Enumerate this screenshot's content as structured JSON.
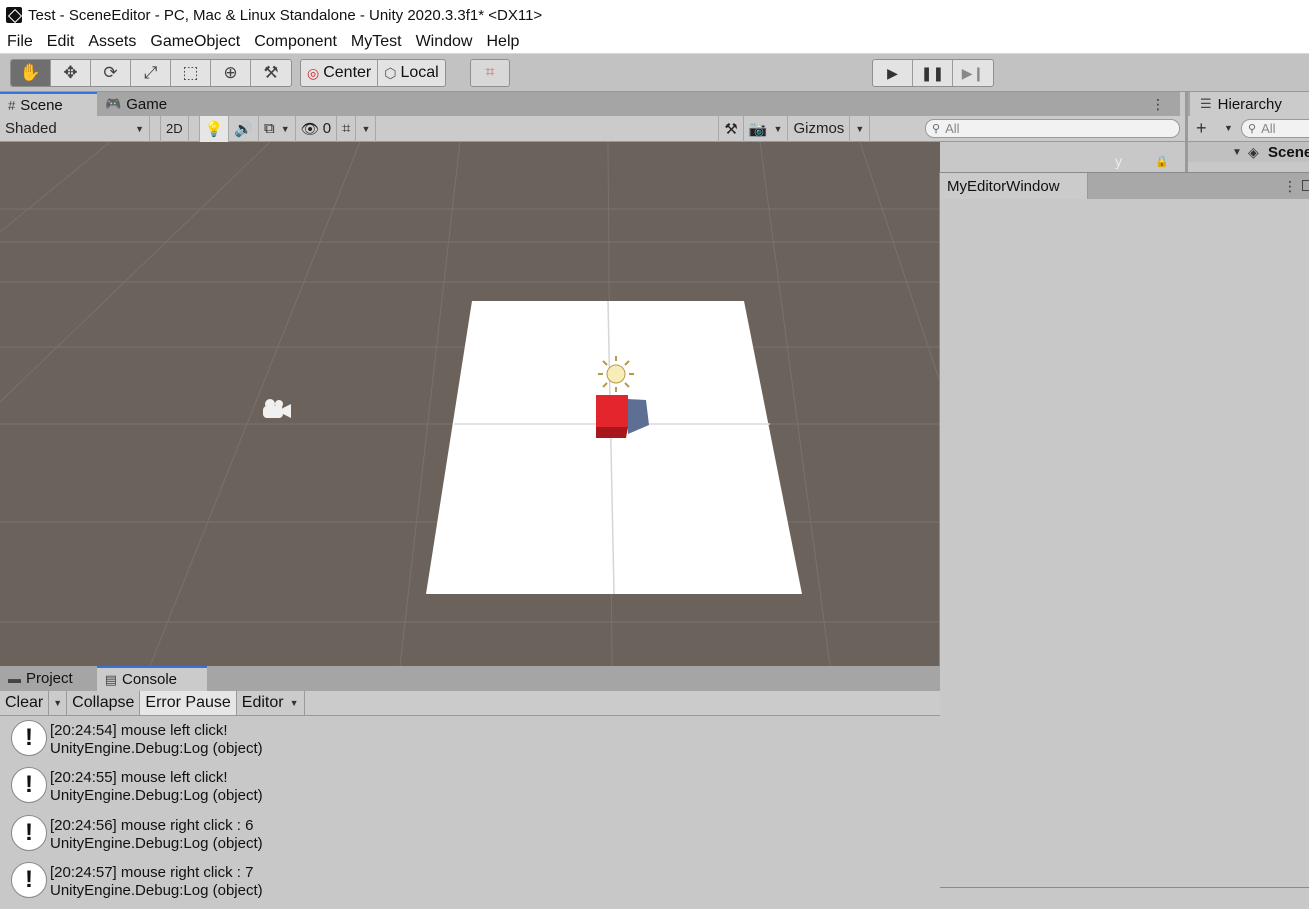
{
  "window": {
    "title": "Test - SceneEditor - PC, Mac & Linux Standalone - Unity 2020.3.3f1* <DX11>"
  },
  "menu": [
    "File",
    "Edit",
    "Assets",
    "GameObject",
    "Component",
    "MyTest",
    "Window",
    "Help"
  ],
  "toolbar": {
    "transform_tools": [
      {
        "name": "hand-tool",
        "icon": "✋",
        "active": true
      },
      {
        "name": "move-tool",
        "icon": "✥",
        "active": false
      },
      {
        "name": "rotate-tool",
        "icon": "⟳",
        "active": false
      },
      {
        "name": "scale-tool",
        "icon": "⤢",
        "active": false
      },
      {
        "name": "rect-tool",
        "icon": "⬚",
        "active": false
      },
      {
        "name": "transform-tool",
        "icon": "⊕",
        "active": false
      },
      {
        "name": "custom-tool",
        "icon": "⚒",
        "active": false
      }
    ],
    "pivot_label": "Center",
    "rotation_label": "Local",
    "snap_icon": "⌗"
  },
  "scene": {
    "tabs": [
      "Scene",
      "Game"
    ],
    "shading_mode": "Shaded",
    "mode_2d": "2D",
    "hidden_count": "0",
    "gizmos_label": "Gizmos",
    "search_placeholder": "All",
    "axis_label": "y",
    "colors": {
      "ground": "#6b625c",
      "plane": "#ffffff",
      "cube": "#e3262d",
      "shadow": "#5e6f94"
    }
  },
  "hierarchy": {
    "tab_label": "Hierarchy",
    "search_placeholder": "All",
    "scene_label": "Scene"
  },
  "editor_window": {
    "title": "MyEditorWindow"
  },
  "bottom": {
    "tabs": [
      "Project",
      "Console"
    ],
    "console_toolbar": {
      "clear": "Clear",
      "collapse": "Collapse",
      "error_pause": "Error Pause",
      "editor": "Editor"
    },
    "logs": [
      {
        "message": "[20:24:54] mouse left click!",
        "detail": "UnityEngine.Debug:Log (object)"
      },
      {
        "message": "[20:24:55] mouse left click!",
        "detail": "UnityEngine.Debug:Log (object)"
      },
      {
        "message": "[20:24:56] mouse right click : 6",
        "detail": "UnityEngine.Debug:Log (object)"
      },
      {
        "message": "[20:24:57] mouse right click : 7",
        "detail": "UnityEngine.Debug:Log (object)"
      }
    ]
  }
}
